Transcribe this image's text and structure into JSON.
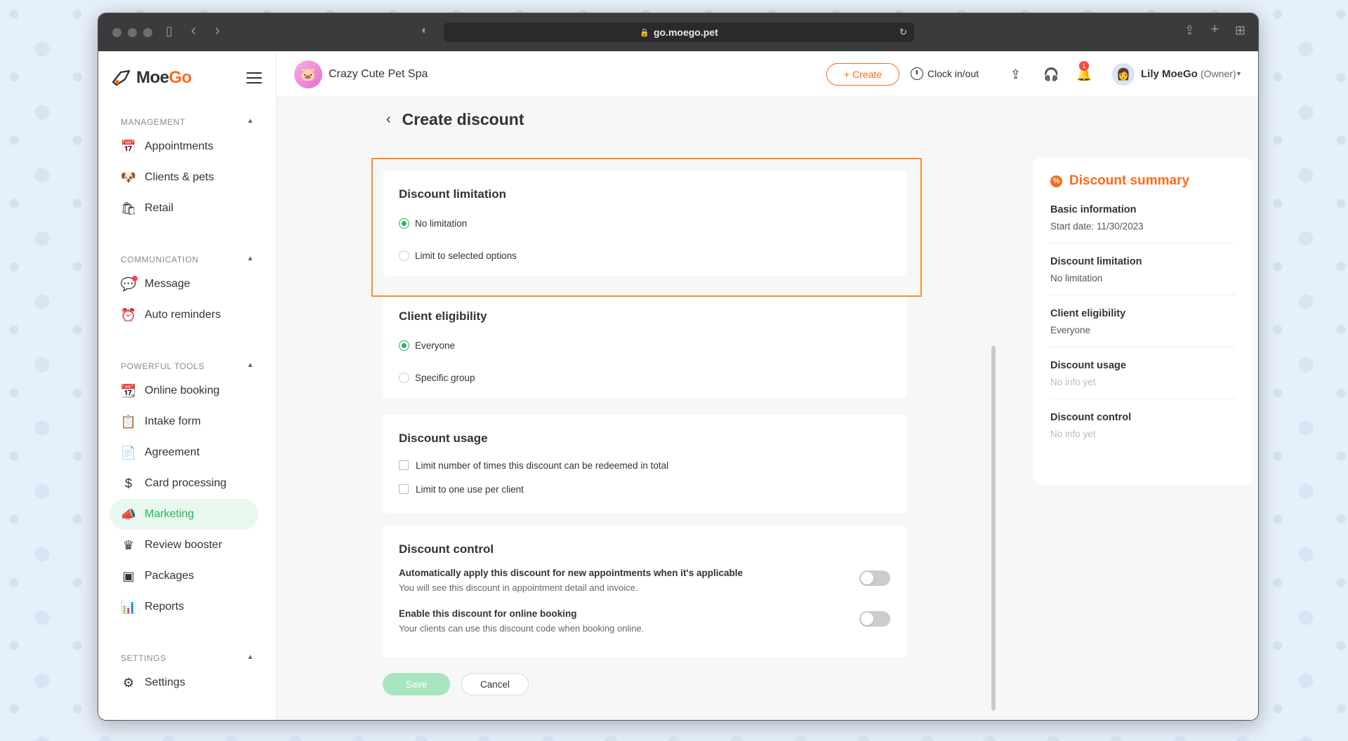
{
  "browser": {
    "url": "go.moego.pet"
  },
  "brand": {
    "name_prefix": "Moe",
    "name_suffix": "Go",
    "accent_color": "#f96b18",
    "green_color": "#1fb85e"
  },
  "sidebar": {
    "sections": [
      {
        "title": "MANAGEMENT",
        "items": [
          {
            "label": "Appointments",
            "icon": "calendar-icon"
          },
          {
            "label": "Clients & pets",
            "icon": "dog-icon"
          },
          {
            "label": "Retail",
            "icon": "retail-icon"
          }
        ]
      },
      {
        "title": "COMMUNICATION",
        "items": [
          {
            "label": "Message",
            "icon": "message-icon"
          },
          {
            "label": "Auto reminders",
            "icon": "alarm-icon"
          }
        ]
      },
      {
        "title": "POWERFUL TOOLS",
        "items": [
          {
            "label": "Online booking",
            "icon": "calendar-icon"
          },
          {
            "label": "Intake form",
            "icon": "form-icon"
          },
          {
            "label": "Agreement",
            "icon": "agreement-icon"
          },
          {
            "label": "Card processing",
            "icon": "dollar-icon"
          },
          {
            "label": "Marketing",
            "icon": "megaphone-icon"
          },
          {
            "label": "Review booster",
            "icon": "crown-icon"
          },
          {
            "label": "Packages",
            "icon": "package-icon"
          },
          {
            "label": "Reports",
            "icon": "chart-icon"
          }
        ]
      },
      {
        "title": "SETTINGS",
        "items": [
          {
            "label": "Settings",
            "icon": "gear-icon"
          }
        ]
      }
    ]
  },
  "topbar": {
    "business_name": "Crazy Cute Pet Spa",
    "create_label": "Create",
    "clock_label": "Clock in/out",
    "notification_count": "1",
    "user_name": "Lily MoeGo",
    "user_role": "(Owner)"
  },
  "page": {
    "title": "Create discount",
    "limitation": {
      "title": "Discount limitation",
      "options": [
        "No limitation",
        "Limit to selected options"
      ]
    },
    "eligibility": {
      "title": "Client eligibility",
      "options": [
        "Everyone",
        "Specific group"
      ]
    },
    "usage": {
      "title": "Discount usage",
      "options": [
        "Limit number of times this discount can be redeemed in total",
        "Limit to one use per client"
      ]
    },
    "control": {
      "title": "Discount control",
      "rows": [
        {
          "title": "Automatically apply this discount for new appointments when it's applicable",
          "desc": "You will see this discount in appointment detail and invoice."
        },
        {
          "title": "Enable this discount for online booking",
          "desc": "Your clients can use this discount code when booking online."
        }
      ]
    },
    "save_label": "Save",
    "cancel_label": "Cancel"
  },
  "summary": {
    "title": "Discount summary",
    "blocks": [
      {
        "label": "Basic information",
        "value": "Start date: 11/30/2023",
        "muted": false
      },
      {
        "label": "Discount limitation",
        "value": "No limitation",
        "muted": false
      },
      {
        "label": "Client eligibility",
        "value": "Everyone",
        "muted": false
      },
      {
        "label": "Discount usage",
        "value": "No info yet",
        "muted": true
      },
      {
        "label": "Discount control",
        "value": "No info yet",
        "muted": true
      }
    ]
  }
}
